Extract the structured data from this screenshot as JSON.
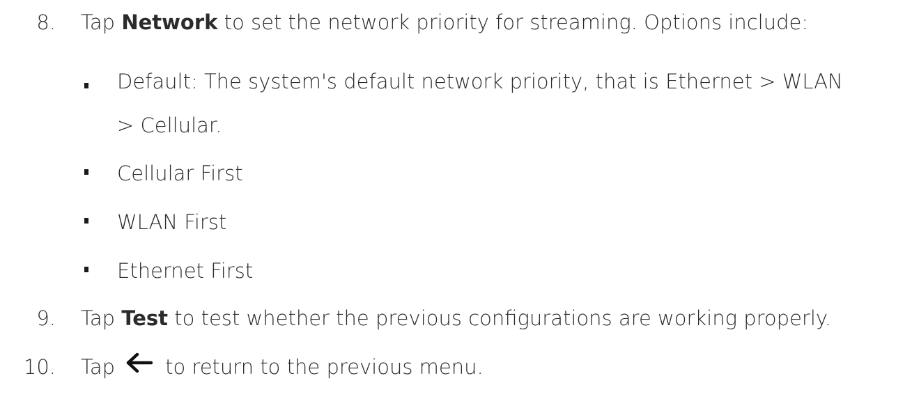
{
  "steps": [
    {
      "number": "8.",
      "pre": "Tap ",
      "bold": "Network",
      "post": " to set the network priority for streaming. Options include:"
    },
    {
      "number": "9.",
      "pre": "Tap ",
      "bold": "Test",
      "post": " to test whether the previous configurations are working properly."
    },
    {
      "number": "10.",
      "pre": "Tap",
      "icon": "back-arrow-icon",
      "post": "to return to the previous menu."
    }
  ],
  "options": [
    {
      "line1": "Default: The system's default network priority, that is Ethernet > WLAN",
      "line2": "> Cellular."
    },
    {
      "line1": "Cellular First"
    },
    {
      "line1": "WLAN First"
    },
    {
      "line1": "Ethernet First"
    }
  ]
}
